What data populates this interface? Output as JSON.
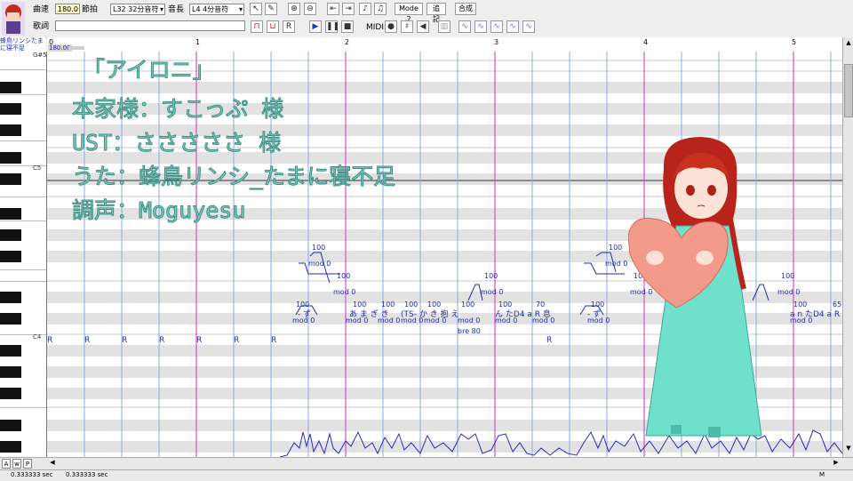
{
  "toolbar": {
    "tempo_label": "曲速",
    "tempo_value": "180.0",
    "beat_label": "節拍",
    "quantize_select": "L32 32分音符",
    "length_label": "音長",
    "length_select": "L4  4分音符",
    "lyric_label": "歌詞",
    "midi_label": "MIDI",
    "mode_button": "Mode 2",
    "append_button": "追記",
    "synth_button": "合成"
  },
  "ruler": {
    "measures": [
      "0",
      "1",
      "2",
      "3",
      "4",
      "5"
    ],
    "tempo_marker": "180.00",
    "voicebank_line1": "蜂鳥リンシたま",
    "voicebank_line2": "に寝不足"
  },
  "piano": {
    "labels": [
      "G#5",
      "C5",
      "C4"
    ]
  },
  "overlay": {
    "line1": "「アイロニ」",
    "line2": "本家様：すこっぷ 様",
    "line3": "UST：さささささ 様",
    "line4": "うた：蜂鳥リンシ_たまに寝不足",
    "line5": "調声：Moguyesu"
  },
  "notes": {
    "rest": "R",
    "pitch_100": "100",
    "pitch_70": "70",
    "pitch_65": "65",
    "mod": "mod 0",
    "bre": "bre 80",
    "lyric_a": "- ず",
    "lyric_b": "あ ま ぎ き",
    "lyric_c": "(TS- か き 抱 え",
    "lyric_d": "ん たD4 a R 息",
    "lyric_e": "- ず",
    "lyric_f": "a n たD4 a R"
  },
  "status": {
    "left_time": "0.333333 sec",
    "mid_time": "0.333333 sec",
    "right_label": "M"
  },
  "colors": {
    "beat_line": "#d84ed0",
    "grid_blue": "#8fa6e8",
    "note_blue": "#1b2db0",
    "overlay_text": "#7ad1c0",
    "pitch_wave": "#2a2ac8"
  }
}
